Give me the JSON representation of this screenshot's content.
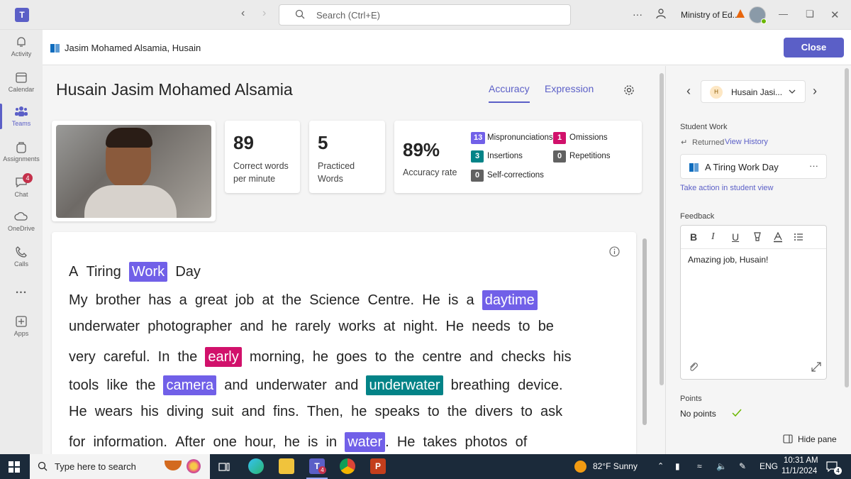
{
  "titlebar": {
    "search_placeholder": "Search (Ctrl+E)",
    "org_name": "Ministry of Ed...",
    "more": "···"
  },
  "rail": {
    "items": [
      {
        "label": "Activity",
        "icon": "bell-icon"
      },
      {
        "label": "Calendar",
        "icon": "calendar-icon"
      },
      {
        "label": "Teams",
        "icon": "teams-icon",
        "active": true
      },
      {
        "label": "Assignments",
        "icon": "backpack-icon"
      },
      {
        "label": "Chat",
        "icon": "chat-icon",
        "badge": "4"
      },
      {
        "label": "OneDrive",
        "icon": "cloud-icon"
      },
      {
        "label": "Calls",
        "icon": "phone-icon"
      },
      {
        "label": "...",
        "icon": "more-icon"
      },
      {
        "label": "Apps",
        "icon": "apps-icon"
      }
    ]
  },
  "header": {
    "title": "Jasim Mohamed Alsamia, Husain",
    "close_label": "Close"
  },
  "main": {
    "student_name": "Husain Jasim Mohamed Alsamia",
    "tabs": [
      {
        "label": "Accuracy",
        "selected": true
      },
      {
        "label": "Expression",
        "selected": false
      }
    ],
    "stats": {
      "wcpm_value": "89",
      "wcpm_label_1": "Correct words",
      "wcpm_label_2": "per minute",
      "practiced_value": "5",
      "practiced_label_1": "Practiced",
      "practiced_label_2": "Words",
      "accuracy_value": "89%",
      "accuracy_label": "Accuracy rate"
    },
    "errors": [
      {
        "count": "13",
        "label": "Mispronunciations",
        "color": "#7160e8"
      },
      {
        "count": "1",
        "label": "Omissions",
        "color": "#d1116b"
      },
      {
        "count": "3",
        "label": "Insertions",
        "color": "#038387"
      },
      {
        "count": "0",
        "label": "Repetitions",
        "color": "#616161"
      },
      {
        "count": "0",
        "label": "Self-corrections",
        "color": "#616161"
      }
    ],
    "reading": {
      "lines": [
        [
          [
            "A",
            ""
          ],
          [
            "Tiring",
            ""
          ],
          [
            "Work",
            "mp"
          ],
          [
            "Day",
            ""
          ]
        ],
        [
          [
            "My",
            ""
          ],
          [
            "brother",
            ""
          ],
          [
            "has",
            ""
          ],
          [
            "a",
            ""
          ],
          [
            "great",
            ""
          ],
          [
            "job",
            ""
          ],
          [
            "at",
            ""
          ],
          [
            "the",
            ""
          ],
          [
            "Science",
            ""
          ],
          [
            "Centre.",
            ""
          ],
          [
            "He",
            ""
          ],
          [
            "is",
            ""
          ],
          [
            "a",
            ""
          ],
          [
            "daytime",
            "mp"
          ]
        ],
        [
          [
            "underwater",
            ""
          ],
          [
            "photographer",
            ""
          ],
          [
            "and",
            ""
          ],
          [
            "he",
            ""
          ],
          [
            "rarely",
            ""
          ],
          [
            "works",
            ""
          ],
          [
            "at",
            ""
          ],
          [
            "night.",
            ""
          ],
          [
            "He",
            ""
          ],
          [
            "needs",
            ""
          ],
          [
            "to",
            ""
          ],
          [
            "be",
            ""
          ]
        ],
        [
          [
            "very",
            ""
          ],
          [
            "careful.",
            ""
          ],
          [
            "In",
            ""
          ],
          [
            "the",
            ""
          ],
          [
            "early",
            "om"
          ],
          [
            "morning,",
            ""
          ],
          [
            "he",
            ""
          ],
          [
            "goes",
            ""
          ],
          [
            "to",
            ""
          ],
          [
            "the",
            ""
          ],
          [
            "centre",
            ""
          ],
          [
            "and",
            ""
          ],
          [
            "checks",
            ""
          ],
          [
            "his",
            ""
          ]
        ],
        [
          [
            "tools",
            ""
          ],
          [
            "like",
            ""
          ],
          [
            "the",
            ""
          ],
          [
            "camera",
            "mp"
          ],
          [
            "and",
            ""
          ],
          [
            "underwater",
            ""
          ],
          [
            "and",
            ""
          ],
          [
            "underwater",
            "ins"
          ],
          [
            "breathing",
            ""
          ],
          [
            "device.",
            ""
          ]
        ],
        [
          [
            "He",
            ""
          ],
          [
            "wears",
            ""
          ],
          [
            "his",
            ""
          ],
          [
            "diving",
            ""
          ],
          [
            "suit",
            ""
          ],
          [
            "and",
            ""
          ],
          [
            "fins.",
            ""
          ],
          [
            "Then,",
            ""
          ],
          [
            "he",
            ""
          ],
          [
            "speaks",
            ""
          ],
          [
            "to",
            ""
          ],
          [
            "the",
            ""
          ],
          [
            "divers",
            ""
          ],
          [
            "to",
            ""
          ],
          [
            "ask",
            ""
          ]
        ],
        [
          [
            "for",
            ""
          ],
          [
            "information.",
            ""
          ],
          [
            "After",
            ""
          ],
          [
            "one",
            ""
          ],
          [
            "hour,",
            ""
          ],
          [
            "he",
            ""
          ],
          [
            "is",
            ""
          ],
          [
            "in",
            ""
          ],
          [
            "water",
            "mp"
          ],
          [
            ".",
            ""
          ],
          [
            "He",
            ""
          ],
          [
            "takes",
            ""
          ],
          [
            "photos",
            ""
          ],
          [
            "of",
            ""
          ]
        ]
      ]
    }
  },
  "pane": {
    "student_short": "Husain Jasi...",
    "avatar_initial": "H",
    "student_work_label": "Student Work",
    "returned_label": "Returned",
    "view_history": "View History",
    "work_title": "A Tiring Work Day",
    "take_action": "Take action in student view",
    "feedback_label": "Feedback",
    "feedback_text": "Amazing job, Husain!",
    "points_label": "Points",
    "points_value": "No points",
    "hide_pane": "Hide pane"
  },
  "taskbar": {
    "search_placeholder": "Type here to search",
    "weather": "82°F  Sunny",
    "lang": "ENG",
    "time": "10:31 AM",
    "date": "11/1/2024",
    "teams_badge": "4",
    "notif_badge": "4"
  }
}
